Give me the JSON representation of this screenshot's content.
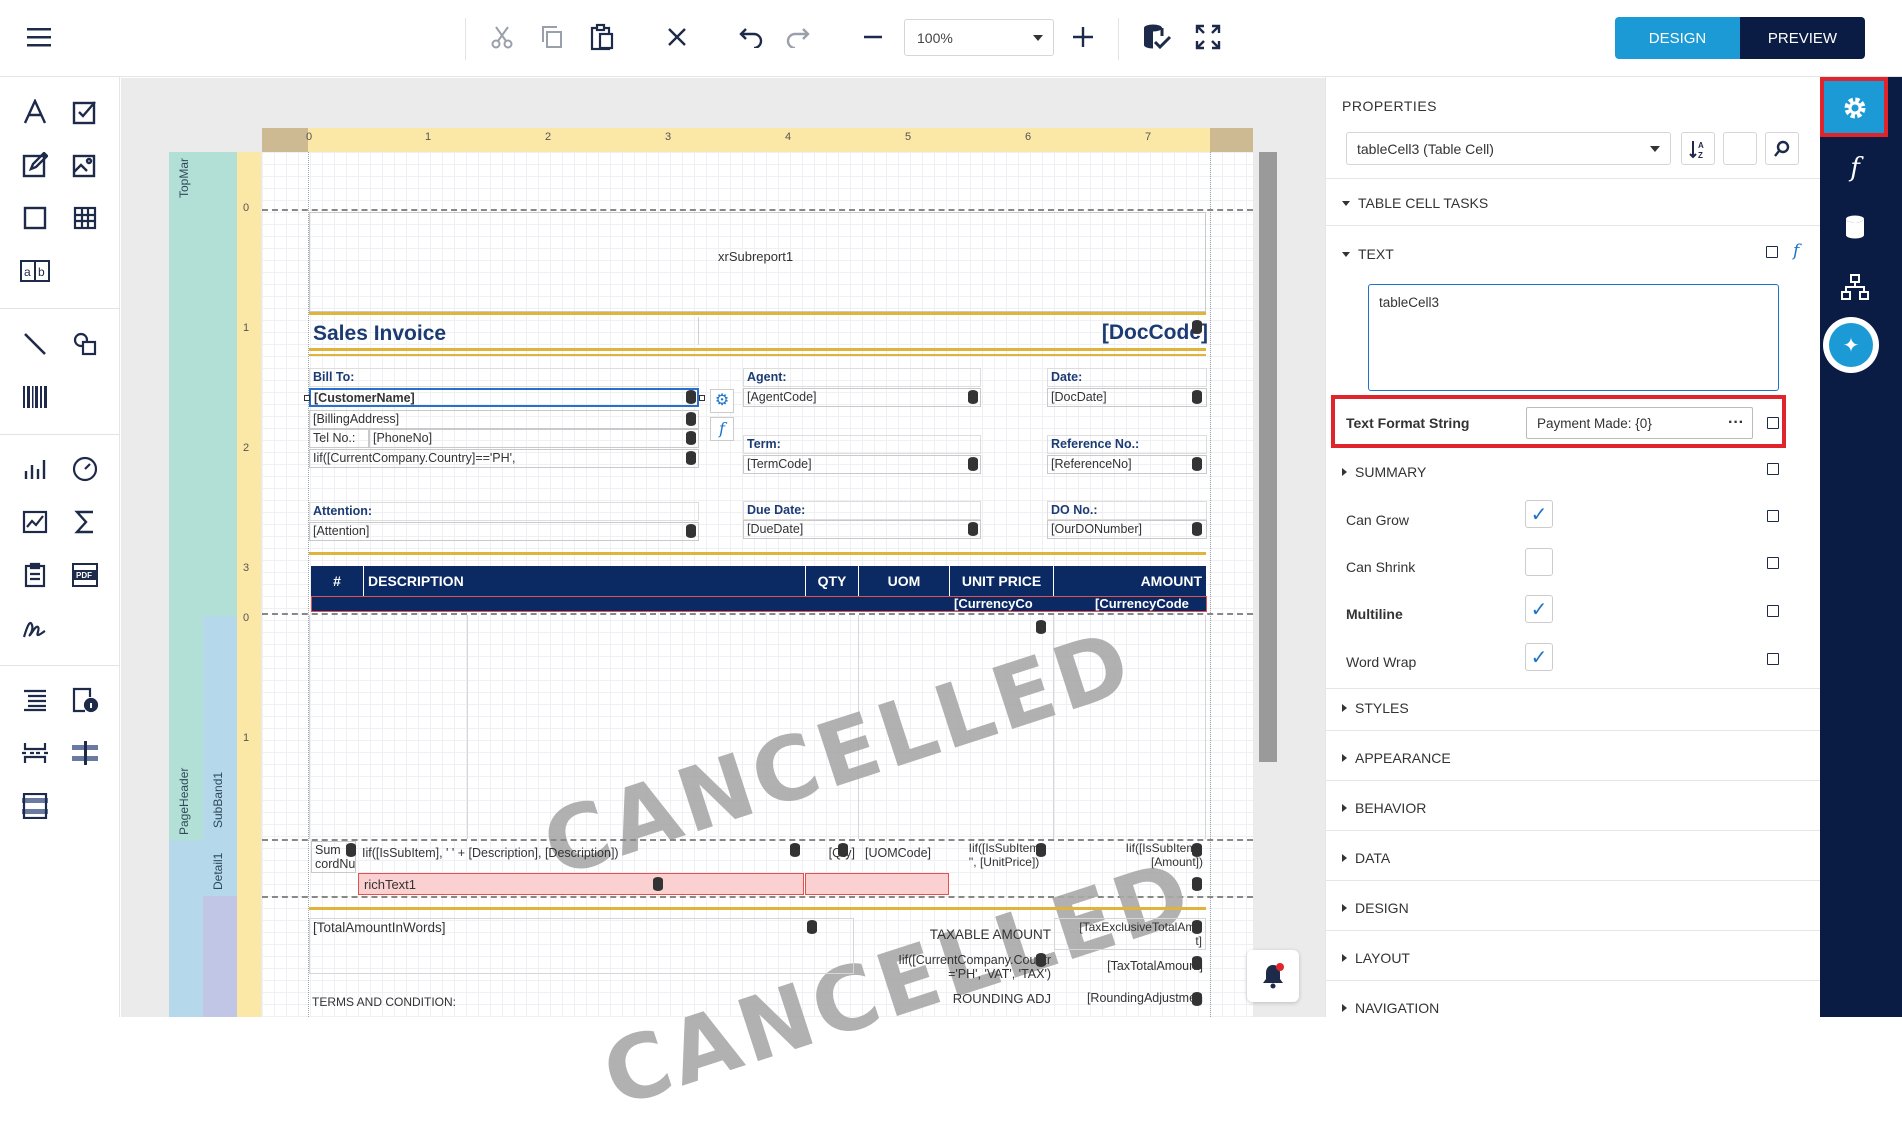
{
  "toolbar": {
    "zoom_value": "100%",
    "design_label": "DESIGN",
    "preview_label": "PREVIEW"
  },
  "ruler": {
    "top_ticks": [
      "0",
      "1",
      "2",
      "3",
      "4",
      "5",
      "6",
      "7"
    ],
    "left_ticks_a": [
      "0",
      "1",
      "2",
      "3"
    ],
    "left_ticks_b": [
      "0",
      "1"
    ]
  },
  "bands": {
    "top_margin": "TopMar",
    "page_header": "PageHeader",
    "sub_band": "SubBand1",
    "detail": "Detail1"
  },
  "report": {
    "subreport": "xrSubreport1",
    "title": "Sales Invoice",
    "doc_code": "[DocCode]",
    "bill_to": "Bill To:",
    "customer_name": "[CustomerName]",
    "billing_address": "[BillingAddress]",
    "tel_label": "Tel No.:",
    "phone": "[PhoneNo]",
    "country_expr": "Iif([CurrentCompany.Country]=='PH',",
    "attention_label": "Attention:",
    "attention": "[Attention]",
    "agent_label": "Agent:",
    "agent": "[AgentCode]",
    "term_label": "Term:",
    "term": "[TermCode]",
    "due_label": "Due Date:",
    "due": "[DueDate]",
    "date_label": "Date:",
    "date": "[DocDate]",
    "ref_label": "Reference No.:",
    "ref": "[ReferenceNo]",
    "do_label": "DO No.:",
    "do": "[OurDONumber]",
    "table_headers": [
      "#",
      "DESCRIPTION",
      "QTY",
      "UOM",
      "UNIT PRICE",
      "AMOUNT"
    ],
    "currency_1": "[CurrencyCo",
    "currency_2": "[CurrencyCode",
    "watermark": "CANCELLED",
    "detail_sum": "Sum",
    "detail_record": "cordNu",
    "detail_desc": "Iif([IsSubItem], '   ' + [Description], [Description])",
    "detail_qty": "[Qty]",
    "detail_uom": "[UOMCode]",
    "detail_unit_1": "Iif([IsSubItem",
    "detail_unit_2": "'', [UnitPrice])",
    "detail_amount_1": "Iif([IsSubItem],",
    "detail_amount_2": "[Amount])",
    "rich_text": "richText1",
    "amount_words": "[TotalAmountInWords]",
    "taxable_amount": "TAXABLE AMOUNT",
    "tax_excl_1": "[TaxExclusiveTotalAmo",
    "tax_excl_2": "t]",
    "vat_expr_1": "Iif([CurrentCompany.Countr",
    "vat_expr_2": "='PH', 'VAT', 'TAX')",
    "tax_total": "[TaxTotalAmount]",
    "terms": "TERMS AND CONDITION:",
    "rounding": "ROUNDING ADJ",
    "rounding_val": "[RoundingAdjustmen"
  },
  "properties": {
    "heading": "PROPERTIES",
    "selected_component": "tableCell3 (Table Cell)",
    "tasks": "TABLE CELL TASKS",
    "text_section": "TEXT",
    "text_value": "tableCell3",
    "format_label": "Text Format String",
    "format_value": "Payment Made: {0}",
    "summary": "SUMMARY",
    "can_grow": "Can Grow",
    "can_shrink": "Can Shrink",
    "multiline": "Multiline",
    "word_wrap": "Word Wrap",
    "styles": "STYLES",
    "appearance": "APPEARANCE",
    "behavior": "BEHAVIOR",
    "data": "DATA",
    "design": "DESIGN",
    "layout": "LAYOUT",
    "navigation": "NAVIGATION"
  },
  "colors": {
    "accent": "#1b9ad6",
    "navy": "#0b1c44",
    "highlight": "#e0242c",
    "band_green": "#b3e0d6",
    "band_blue": "#b5d8ea",
    "ruler": "#fbe7a6"
  }
}
